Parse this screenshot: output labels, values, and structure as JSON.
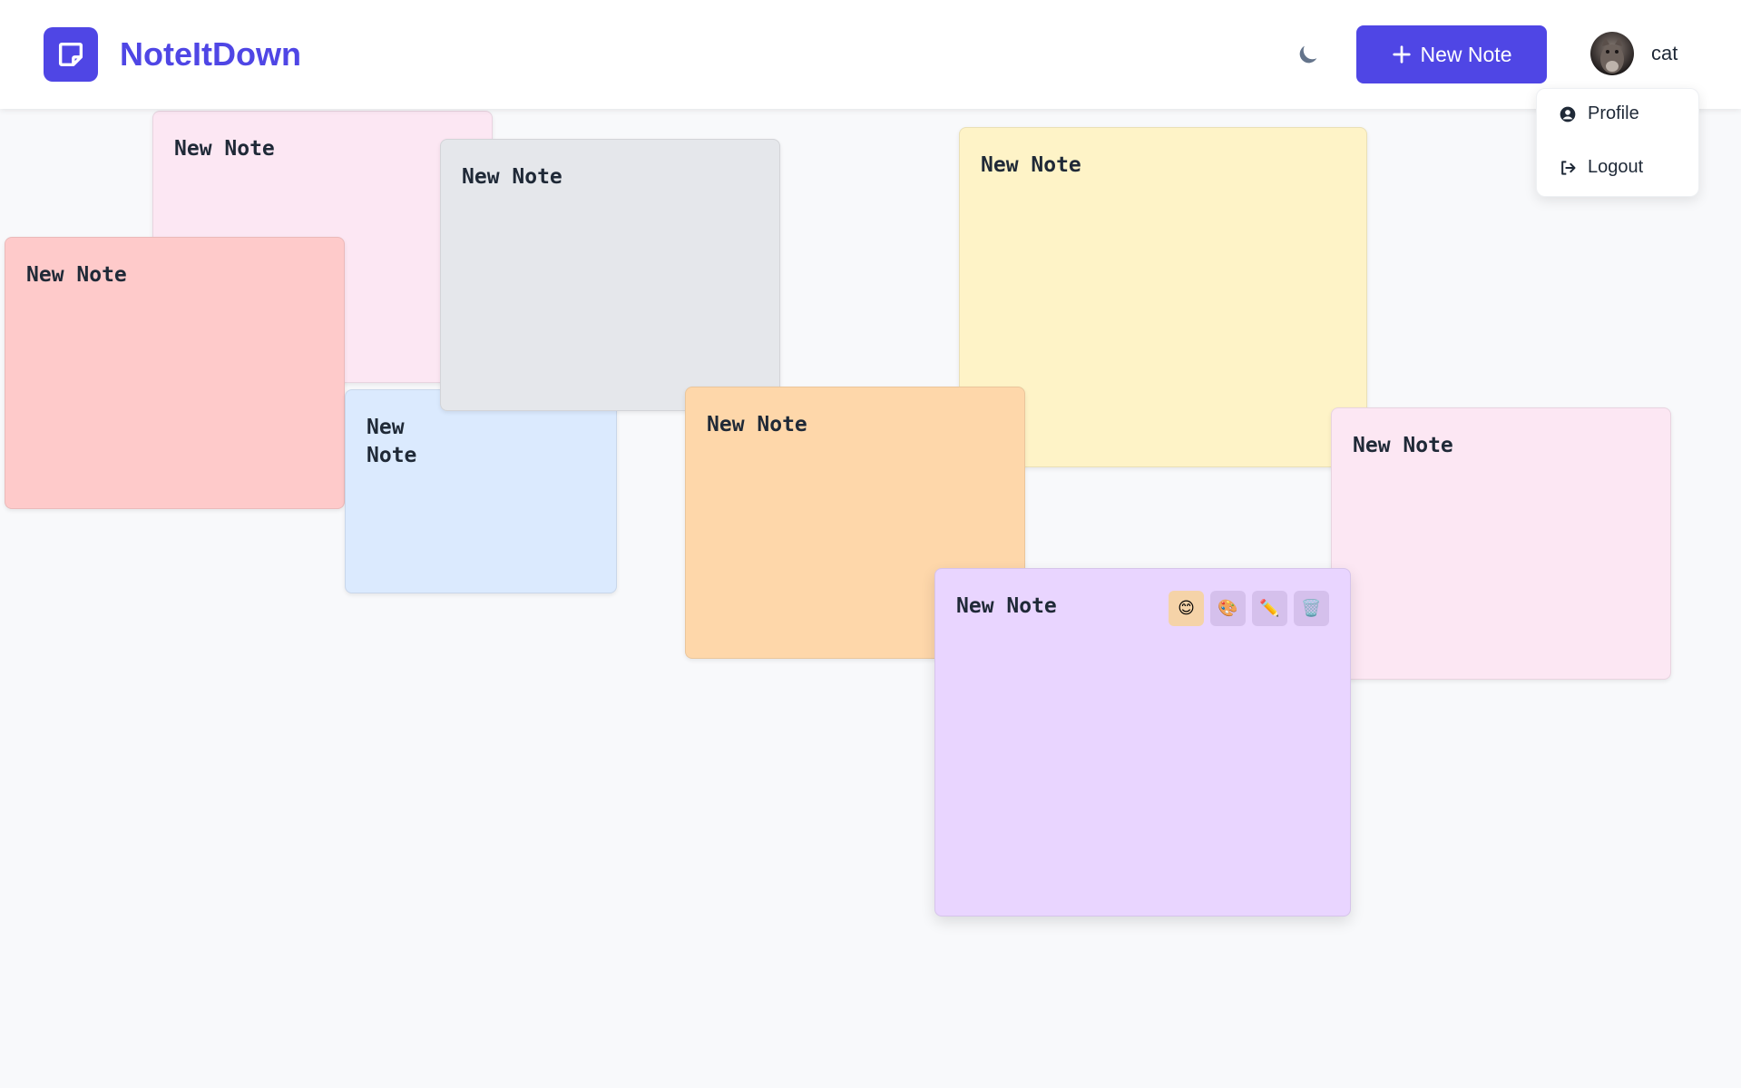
{
  "app": {
    "name": "NoteItDown"
  },
  "header": {
    "new_note_label": "New Note",
    "username": "cat"
  },
  "user_menu": {
    "items": [
      {
        "label": "Profile",
        "icon": "user-circle-icon"
      },
      {
        "label": "Logout",
        "icon": "logout-icon"
      }
    ]
  },
  "notes": [
    {
      "title": "New Note",
      "color": "#fce7f3"
    },
    {
      "title": "New Note",
      "color": "#fecaca"
    },
    {
      "title": "New Note",
      "color": "#dbeafe"
    },
    {
      "title": "New Note",
      "color": "#e5e7eb"
    },
    {
      "title": "New Note",
      "color": "#fed7aa"
    },
    {
      "title": "New Note",
      "color": "#fef3c7"
    },
    {
      "title": "New Note",
      "color": "#fce7f3"
    },
    {
      "title": "New Note",
      "color": "#e9d5ff"
    }
  ],
  "note_tools": [
    {
      "name": "emoji-button",
      "glyph": "😊"
    },
    {
      "name": "color-palette-button",
      "glyph": "🎨"
    },
    {
      "name": "edit-button",
      "glyph": "✏️"
    },
    {
      "name": "delete-button",
      "glyph": "🗑️"
    }
  ],
  "colors": {
    "accent": "#4f46e5",
    "background": "#f8f9fb"
  }
}
